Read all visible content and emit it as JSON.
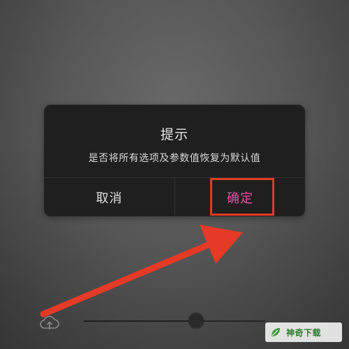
{
  "dialog": {
    "title": "提示",
    "message": "是否将所有选项及参数值恢复为默认值",
    "cancel_label": "取消",
    "confirm_label": "确定",
    "confirm_color": "#e64ea5"
  },
  "annotation": {
    "box_color": "#e53a26",
    "arrow_color": "#e53a26"
  },
  "toolbar": {
    "upload_icon": "cloud-upload-icon",
    "slider_value_fraction": 0.62
  },
  "watermark": {
    "text": "神奇下载"
  }
}
